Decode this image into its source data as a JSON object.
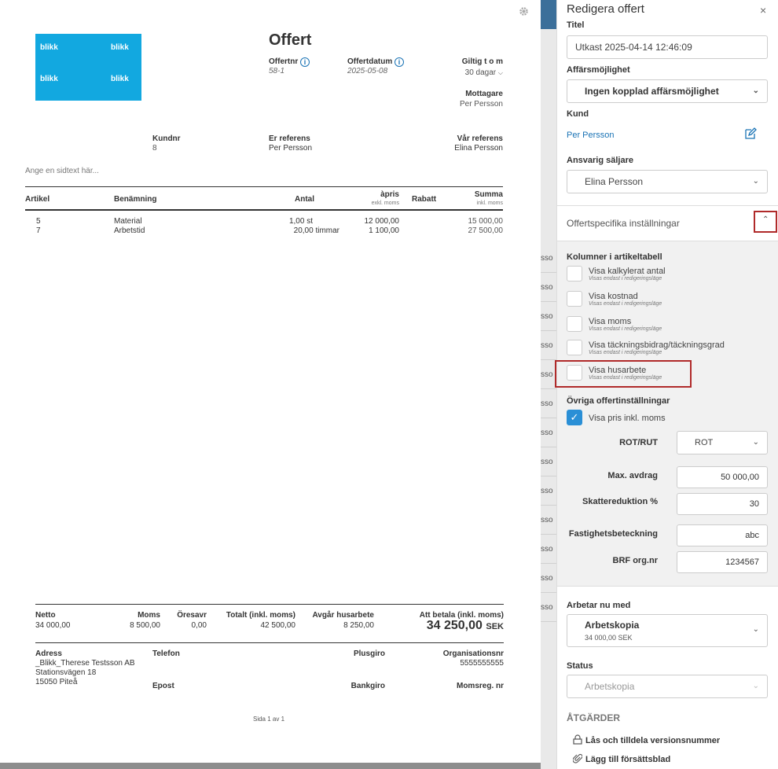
{
  "bg_rows": [
    "sso",
    "sso",
    "sso",
    "sso",
    "sso",
    "sso",
    "sso",
    "sso",
    "sso",
    "sso",
    "sso",
    "sso",
    "sso"
  ],
  "doc": {
    "logo_text": "blikk",
    "heading": "Offert",
    "offertnr_label": "Offertnr",
    "offertnr": "58-1",
    "offertdatum_label": "Offertdatum",
    "offertdatum": "2025-05-08",
    "giltig_label": "Giltig t o m",
    "giltig_value": "30 dagar",
    "mottagare_label": "Mottagare",
    "mottagare_value": "Per Persson",
    "kundnr_label": "Kundnr",
    "kundnr": "8",
    "er_ref_label": "Er referens",
    "er_ref": "Per Persson",
    "var_ref_label": "Vår referens",
    "var_ref": "Elina Persson",
    "sidtext": "Ange en sidtext här...",
    "cols": {
      "artikel": "Artikel",
      "benamning": "Benämning",
      "antal": "Antal",
      "apris": "àpris",
      "apris_sub": "exkl. moms",
      "rabatt": "Rabatt",
      "summa": "Summa",
      "summa_sub": "inkl. moms"
    },
    "rows": [
      {
        "artikel": "5",
        "benamning": "Material",
        "antal": "1,00 st",
        "apris": "12 000,00",
        "summa": "15 000,00"
      },
      {
        "artikel": "7",
        "benamning": "Arbetstid",
        "antal": "20,00 timmar",
        "apris": "1 100,00",
        "summa": "27 500,00"
      }
    ],
    "totals": {
      "netto_label": "Netto",
      "netto": "34 000,00",
      "moms_label": "Moms",
      "moms": "8 500,00",
      "oresavr_label": "Öresavr",
      "oresavr": "0,00",
      "totalt_label": "Totalt (inkl. moms)",
      "totalt": "42 500,00",
      "husarbete_label": "Avgår husarbete",
      "husarbete": "8 250,00",
      "att_betala_label": "Att betala (inkl. moms)",
      "att_betala": "34 250,00",
      "currency": "SEK"
    },
    "footer": {
      "adress_label": "Adress",
      "adress_lines": [
        "_Blikk_Therese Testsson AB",
        "Stationsvägen 18",
        "15050 Piteå"
      ],
      "telefon_label": "Telefon",
      "epost_label": "Epost",
      "plusgiro_label": "Plusgiro",
      "bankgiro_label": "Bankgiro",
      "orgnr_label": "Organisationsnr",
      "orgnr": "5555555555",
      "momsreg_label": "Momsreg. nr",
      "page": "Sida 1 av 1"
    }
  },
  "panel": {
    "title": "Redigera offert",
    "close": "×",
    "titel_label": "Titel",
    "titel_value": "Utkast 2025-04-14 12:46:09",
    "affars_label": "Affärsmöjlighet",
    "affars_value": "Ingen kopplad affärsmöjlighet",
    "kund_label": "Kund",
    "kund_value": "Per Persson",
    "saljare_label": "Ansvarig säljare",
    "saljare_value": "Elina Persson",
    "offertspec_label": "Offertspecifika inställningar",
    "kolumner_label": "Kolumner i artikeltabell",
    "checkboxes": [
      {
        "label": "Visa kalkylerat antal",
        "sub": "Visas endast i redigeringsläge"
      },
      {
        "label": "Visa kostnad",
        "sub": "Visas endast i redigeringsläge"
      },
      {
        "label": "Visa moms",
        "sub": "Visas endast i redigeringsläge"
      },
      {
        "label": "Visa täckningsbidrag/täckningsgrad",
        "sub": "Visas endast i redigeringsläge"
      },
      {
        "label": "Visa husarbete",
        "sub": "Visas endast i redigeringsläge"
      }
    ],
    "ovriga_label": "Övriga offertinställningar",
    "visa_pris_label": "Visa pris inkl. moms",
    "rotrut_label": "ROT/RUT",
    "rotrut_value": "ROT",
    "maxavdrag_label": "Max. avdrag",
    "maxavdrag_value": "50 000,00",
    "skatt_label": "Skattereduktion %",
    "skatt_value": "30",
    "fastighet_label": "Fastighetsbeteckning",
    "fastighet_value": "abc",
    "brf_label": "BRF org.nr",
    "brf_value": "1234567",
    "arbetar_label": "Arbetar nu med",
    "arbetar_value": "Arbetskopia",
    "arbetar_sub": "34 000,00 SEK",
    "status_label": "Status",
    "status_value": "Arbetskopia",
    "atgarder_label": "ÅTGÄRDER",
    "lock_label": "Lås och tilldela versionsnummer",
    "attach_label": "Lägg till försättsblad"
  }
}
